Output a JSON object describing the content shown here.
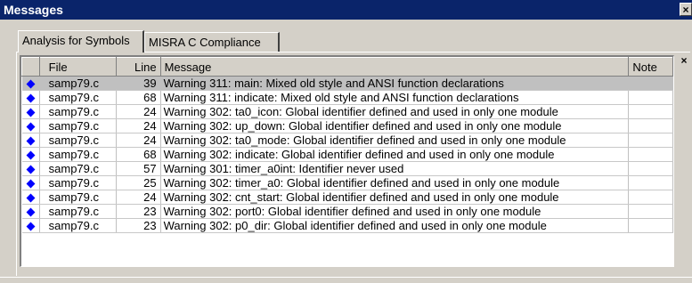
{
  "window": {
    "title": "Messages",
    "close_glyph": "×"
  },
  "tabs": [
    {
      "label": "Analysis for Symbols",
      "active": true
    },
    {
      "label": "MISRA C Compliance",
      "active": false
    }
  ],
  "pane_close_glyph": "×",
  "table": {
    "columns": [
      "",
      "File",
      "Line",
      "Message",
      "Note"
    ],
    "rows": [
      {
        "file": "samp79.c",
        "line": "39",
        "message": "Warning 311: main: Mixed old style and ANSI function declarations",
        "note": "",
        "selected": true
      },
      {
        "file": "samp79.c",
        "line": "68",
        "message": "Warning 311: indicate: Mixed old style and ANSI function declarations",
        "note": ""
      },
      {
        "file": "samp79.c",
        "line": "24",
        "message": "Warning 302: ta0_icon: Global identifier defined and used in only one module",
        "note": ""
      },
      {
        "file": "samp79.c",
        "line": "24",
        "message": "Warning 302: up_down: Global identifier defined and used in only one module",
        "note": ""
      },
      {
        "file": "samp79.c",
        "line": "24",
        "message": "Warning 302: ta0_mode: Global identifier defined and used in only one module",
        "note": ""
      },
      {
        "file": "samp79.c",
        "line": "68",
        "message": "Warning 302: indicate: Global identifier defined and used in only one module",
        "note": ""
      },
      {
        "file": "samp79.c",
        "line": "57",
        "message": "Warning 301: timer_a0int: Identifier never used",
        "note": ""
      },
      {
        "file": "samp79.c",
        "line": "25",
        "message": "Warning 302: timer_a0: Global identifier defined and used in only one module",
        "note": ""
      },
      {
        "file": "samp79.c",
        "line": "24",
        "message": "Warning 302: cnt_start: Global identifier defined and used in only one module",
        "note": ""
      },
      {
        "file": "samp79.c",
        "line": "23",
        "message": "Warning 302: port0: Global identifier defined and used in only one module",
        "note": ""
      },
      {
        "file": "samp79.c",
        "line": "23",
        "message": "Warning 302: p0_dir: Global identifier defined and used in only one module",
        "note": ""
      }
    ]
  },
  "colors": {
    "titlebar": "#0a246a",
    "bullet": "#0000ff",
    "selected_row": "#c0c0c0"
  }
}
